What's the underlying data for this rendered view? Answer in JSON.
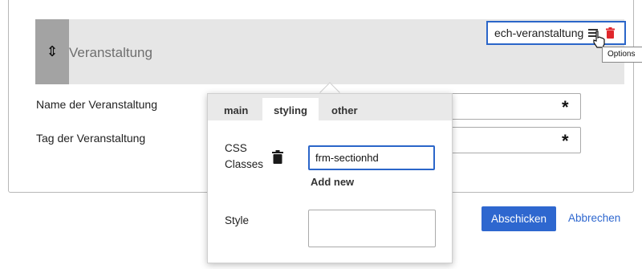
{
  "section": {
    "title": "Veranstaltung",
    "toolbar_label": "ech-veranstaltung",
    "tooltip": "Options"
  },
  "fields": [
    {
      "label": "Name der Veranstaltung",
      "required": "*"
    },
    {
      "label": "Tag der Veranstaltung",
      "required": "*"
    }
  ],
  "popover": {
    "tabs": [
      "main",
      "styling",
      "other"
    ],
    "active_tab": "styling",
    "css_classes_label": "CSS Classes",
    "css_classes_value": "frm-sectionhd",
    "add_new_label": "Add new",
    "style_label": "Style",
    "style_value": ""
  },
  "actions": {
    "submit_label": "Abschicken",
    "cancel_label": "Abbrechen"
  },
  "colors": {
    "accent": "#2e67cf",
    "delete": "#e0262b",
    "header_bg": "#e6e6e6",
    "handle_bg": "#a3a3a3"
  },
  "icons": [
    "drag-handle-icon",
    "menu-icon",
    "trash-icon",
    "pointer-hand-icon",
    "resize-grip-icon"
  ]
}
